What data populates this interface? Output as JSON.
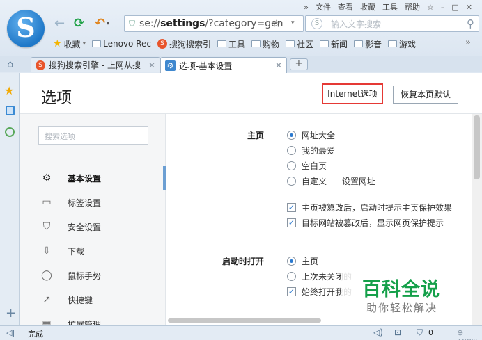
{
  "menubar": {
    "expand": "»",
    "items": [
      "文件",
      "查看",
      "收藏",
      "工具",
      "帮助"
    ],
    "skin": "☆",
    "minimize": "–",
    "maximize": "□",
    "close": "✕"
  },
  "toolbar": {
    "back": "←",
    "reload": "⟳",
    "undo": "↶",
    "undo_caret": "▾",
    "address_scheme": "se://",
    "address_host": "settings",
    "address_path": "/?category=gen",
    "address_star": "☆",
    "address_drop": "▾",
    "search_logo": "S",
    "search_placeholder": "输入文字搜索",
    "search_icon": "⚲"
  },
  "bookmarks": {
    "items": [
      {
        "label": "收藏",
        "icon": "star-icon"
      },
      {
        "label": "Lenovo Rec",
        "icon": "folder-icon"
      },
      {
        "label": "搜狗搜索引",
        "icon": "sogou-icon"
      },
      {
        "label": "工具",
        "icon": "folder-icon"
      },
      {
        "label": "购物",
        "icon": "folder-icon"
      },
      {
        "label": "社区",
        "icon": "folder-icon"
      },
      {
        "label": "新闻",
        "icon": "folder-icon"
      },
      {
        "label": "影音",
        "icon": "folder-icon"
      },
      {
        "label": "游戏",
        "icon": "folder-icon"
      }
    ],
    "dropdown": "▾",
    "more": "»"
  },
  "tabs": {
    "home": "⌂",
    "items": [
      {
        "title": "搜狗搜索引擎 - 上网从搜",
        "close": "✕"
      },
      {
        "title": "选项-基本设置",
        "close": "✕"
      }
    ],
    "new_tab": "+"
  },
  "sidebar_left": {
    "star": "★",
    "clock": "◷",
    "add": "+"
  },
  "page": {
    "title": "选项",
    "internet_options": "Internet选项",
    "restore_default": "恢复本页默认",
    "search_placeholder": "搜索选项"
  },
  "nav": {
    "items": [
      {
        "label": "基本设置",
        "icon": "⚙"
      },
      {
        "label": "标签设置",
        "icon": "▭"
      },
      {
        "label": "安全设置",
        "icon": "⛉"
      },
      {
        "label": "下载",
        "icon": "⇩"
      },
      {
        "label": "鼠标手势",
        "icon": "◯"
      },
      {
        "label": "快捷键",
        "icon": "↗"
      },
      {
        "label": "扩展管理",
        "icon": "▦"
      }
    ]
  },
  "settings": {
    "homepage": {
      "label": "主页",
      "options": [
        "网址大全",
        "我的最爱",
        "空白页",
        "自定义"
      ],
      "selected": "网址大全",
      "set_url": "设置网址",
      "checks": [
        {
          "label": "主页被篡改后，启动时提示主页保护效果",
          "checked": true
        },
        {
          "label": "目标网站被篡改后，显示网页保护提示",
          "checked": true
        }
      ]
    },
    "startup": {
      "label": "启动时打开",
      "options": [
        "主页",
        "上次未关闭的"
      ],
      "selected": "主页",
      "check": {
        "label": "始终打开我的",
        "checked": true
      }
    }
  },
  "watermark": {
    "main": "百科全说",
    "sub": "助你轻松解决"
  },
  "statusbar": {
    "toggle": "◁|",
    "text": "完成",
    "sound": "◁)",
    "screenshot": "⊡",
    "shield": "⛉",
    "count": "0",
    "zoom": "⊕ 100%"
  }
}
